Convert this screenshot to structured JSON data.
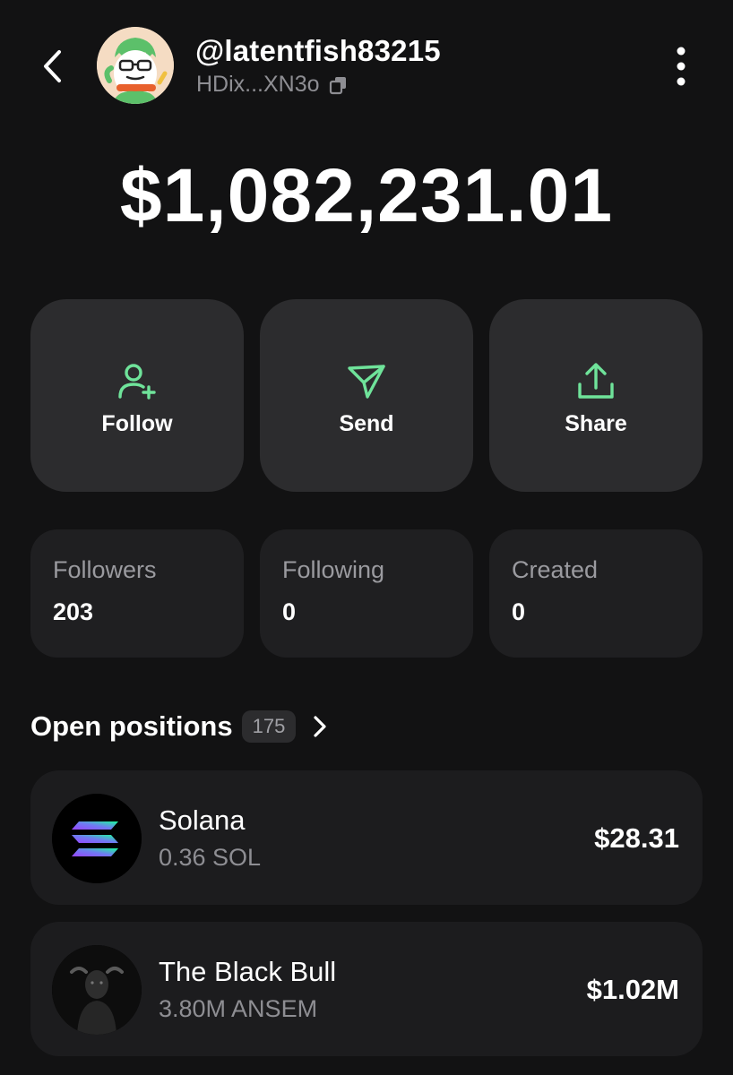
{
  "profile": {
    "username": "@latentfish83215",
    "address": "HDix...XN3o"
  },
  "balance": "$1,082,231.01",
  "actions": [
    {
      "label": "Follow",
      "icon": "user-plus-icon"
    },
    {
      "label": "Send",
      "icon": "send-icon"
    },
    {
      "label": "Share",
      "icon": "share-icon"
    }
  ],
  "stats": [
    {
      "label": "Followers",
      "value": "203"
    },
    {
      "label": "Following",
      "value": "0"
    },
    {
      "label": "Created",
      "value": "0"
    }
  ],
  "positions": {
    "title": "Open positions",
    "count": "175",
    "items": [
      {
        "name": "Solana",
        "amount": "0.36 SOL",
        "value": "$28.31",
        "icon": "solana-logo"
      },
      {
        "name": "The Black Bull",
        "amount": "3.80M ANSEM",
        "value": "$1.02M",
        "icon": "black-bull-logo"
      }
    ]
  },
  "colors": {
    "background": "#121213",
    "card": "#2c2c2e",
    "accent": "#6fe39a",
    "muted": "#8e8e93"
  }
}
